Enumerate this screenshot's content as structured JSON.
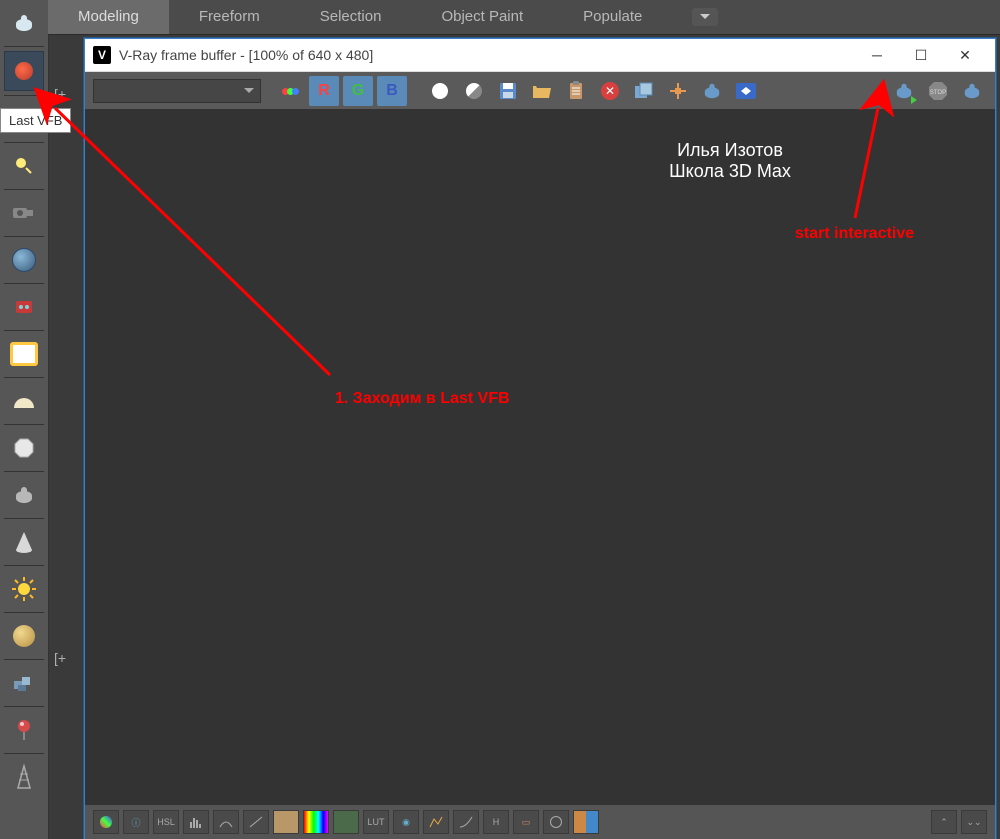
{
  "ribbon": {
    "tabs": [
      "Modeling",
      "Freeform",
      "Selection",
      "Object Paint",
      "Populate"
    ],
    "activeIndex": 0
  },
  "viewport_labels": {
    "primary": "[+",
    "secondary": "[+"
  },
  "tooltip": {
    "text": "Last VFB"
  },
  "vfb": {
    "title": "V-Ray frame buffer - [100% of 640 x 480]",
    "channels": {
      "r": "R",
      "g": "G",
      "b": "B"
    },
    "bottom": {
      "hsl": "HSL",
      "lut": "LUT",
      "h": "H"
    }
  },
  "annotations": {
    "step1": "1. Заходим в Last VFB",
    "start_interactive": "start interactive",
    "credit_line1": "Илья Изотов",
    "credit_line2": "Школа 3D Max"
  },
  "left_tools": [
    "teapot",
    "render",
    "grid",
    "light",
    "camera",
    "globe",
    "robot",
    "plane-yellow",
    "plane-white",
    "octagon",
    "teapot2",
    "cone",
    "sun",
    "sphere",
    "cubes",
    "pin",
    "tower"
  ]
}
